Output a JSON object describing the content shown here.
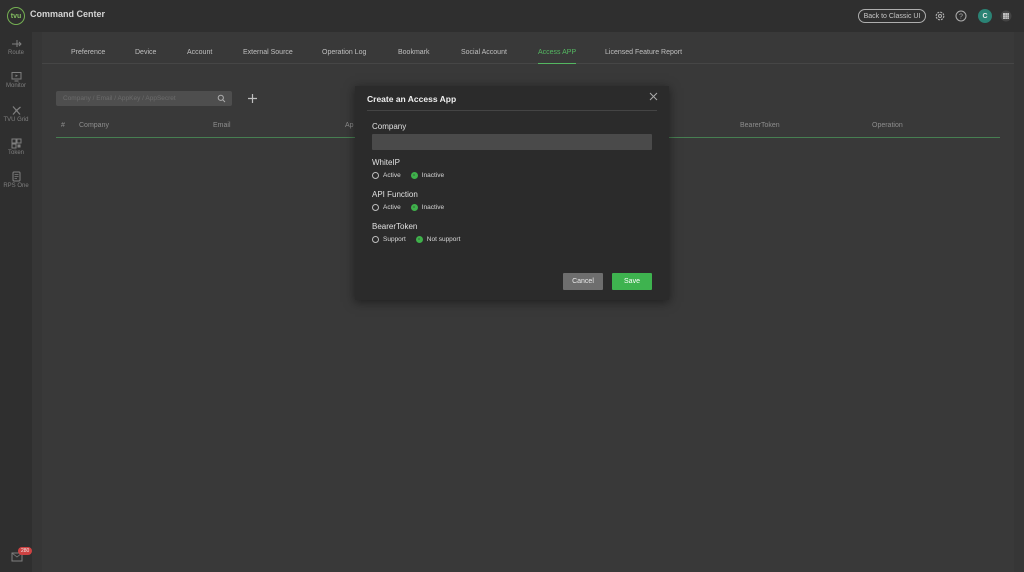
{
  "app": {
    "logo": "tvu",
    "title": "Command Center"
  },
  "topbar": {
    "classic_button": "Back to Classic UI",
    "icons": [
      "gear-icon",
      "help-icon",
      "grid-apps-icon"
    ],
    "avatar_letter": "C"
  },
  "sidebar": {
    "items": [
      {
        "label": "Route",
        "icon": "route-icon"
      },
      {
        "label": "Monitor",
        "icon": "monitor-icon"
      },
      {
        "label": "TVU Grid",
        "icon": "grid-network-icon"
      },
      {
        "label": "Token",
        "icon": "qr-code-icon"
      },
      {
        "label": "RPS One",
        "icon": "rps-icon"
      }
    ],
    "notification_count": "280"
  },
  "tabs": [
    {
      "label": "Preference",
      "active": false
    },
    {
      "label": "Device",
      "active": false
    },
    {
      "label": "Account",
      "active": false
    },
    {
      "label": "External Source",
      "active": false
    },
    {
      "label": "Operation Log",
      "active": false
    },
    {
      "label": "Bookmark",
      "active": false
    },
    {
      "label": "Social Account",
      "active": false
    },
    {
      "label": "Access APP",
      "active": true
    },
    {
      "label": "Licensed Feature Report",
      "active": false
    }
  ],
  "search": {
    "placeholder": "Company / Email / AppKey / AppSecret"
  },
  "table": {
    "headers": [
      "#",
      "Company",
      "Email",
      "Ap",
      "BearerToken",
      "Operation"
    ]
  },
  "modal": {
    "title": "Create an Access App",
    "company_label": "Company",
    "company_value": "",
    "whiteip": {
      "label": "WhiteIP",
      "options": [
        "Active",
        "Inactive"
      ],
      "selected": "Inactive"
    },
    "api_function": {
      "label": "API Function",
      "options": [
        "Active",
        "Inactive"
      ],
      "selected": "Inactive"
    },
    "bearer_token": {
      "label": "BearerToken",
      "options": [
        "Support",
        "Not support"
      ],
      "selected": "Not support"
    },
    "cancel_label": "Cancel",
    "save_label": "Save"
  },
  "colors": {
    "accent": "#3eb34f",
    "active_tab": "#5cc76a",
    "background": "#3b3b3b",
    "modal_bg": "#2b2b2b"
  }
}
